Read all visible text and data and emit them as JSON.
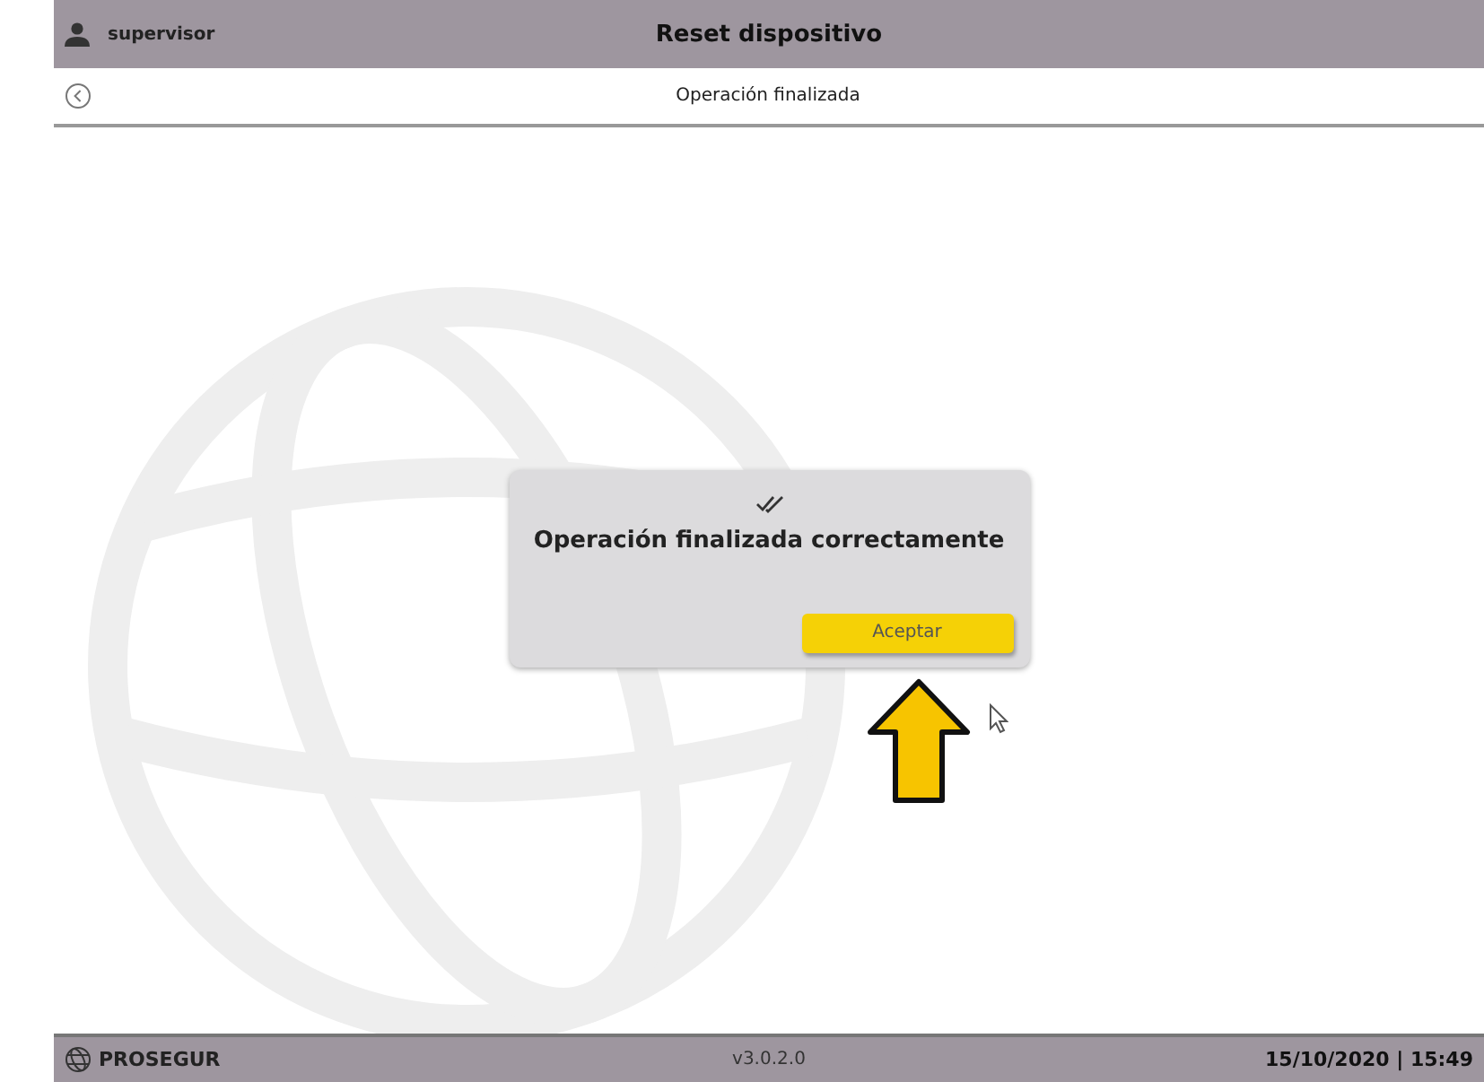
{
  "header": {
    "user": "supervisor",
    "title": "Reset dispositivo"
  },
  "subheader": {
    "title": "Operación finalizada"
  },
  "dialog": {
    "message": "Operación finalizada correctamente",
    "button": "Aceptar"
  },
  "footer": {
    "brand": "PROSEGUR",
    "version": "v3.0.2.0",
    "datetime": "15/10/2020 | 15:49"
  }
}
